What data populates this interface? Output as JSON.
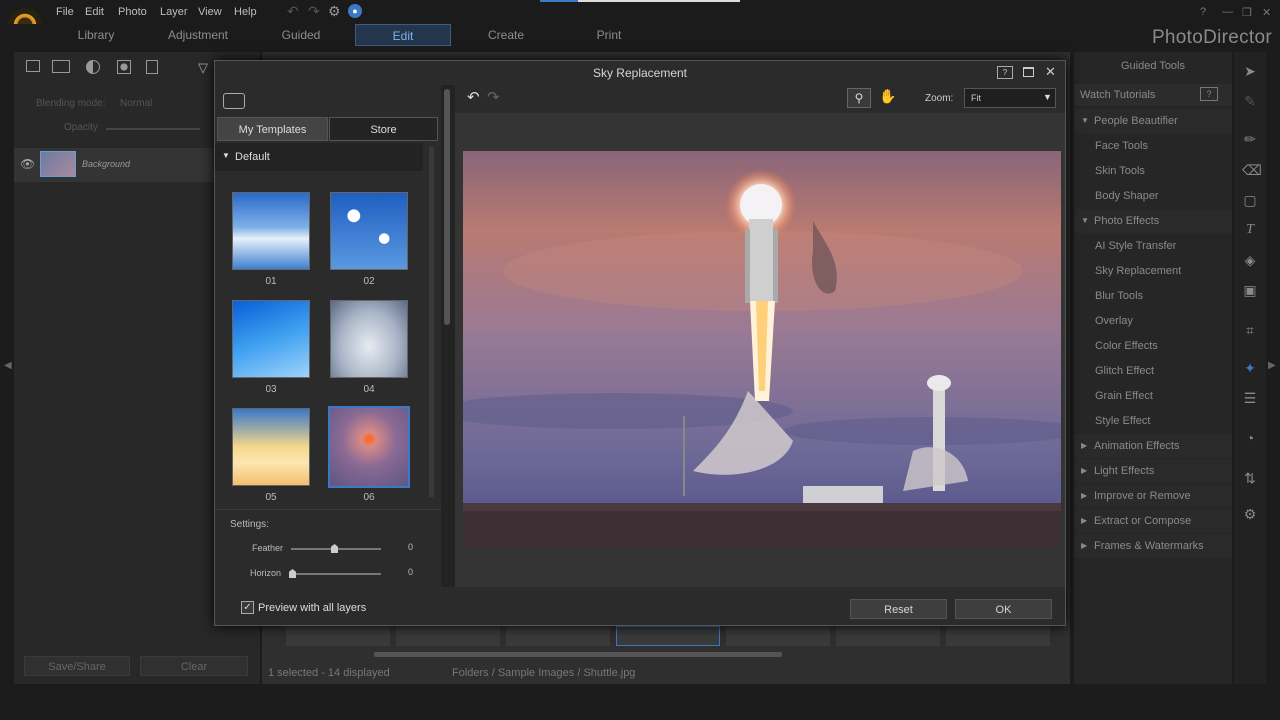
{
  "menu": {
    "items": [
      "File",
      "Edit",
      "Photo",
      "Layer",
      "View",
      "Help"
    ]
  },
  "modules": {
    "tabs": [
      "Library",
      "Adjustment",
      "Guided",
      "Edit",
      "Create",
      "Print"
    ],
    "active": "Edit"
  },
  "brand": "PhotoDirector",
  "left_panel": {
    "blending_label": "Blending mode:",
    "blending_value": "Normal",
    "opacity_label": "Opacity",
    "layer_name": "Background",
    "save_share": "Save/Share",
    "clear": "Clear"
  },
  "status": {
    "selection": "1 selected - 14 displayed",
    "path": "Folders / Sample Images / Shuttle.jpg"
  },
  "right_panel": {
    "title": "Guided Tools",
    "watch_tutorials": "Watch Tutorials",
    "sections": [
      {
        "label": "People Beautifier",
        "expanded": true,
        "items": [
          "Face Tools",
          "Skin Tools",
          "Body Shaper"
        ]
      },
      {
        "label": "Photo Effects",
        "expanded": true,
        "items": [
          "AI Style Transfer",
          "Sky Replacement",
          "Blur Tools",
          "Overlay",
          "Color Effects",
          "Glitch Effect",
          "Grain Effect",
          "Style Effect"
        ]
      },
      {
        "label": "Animation Effects",
        "expanded": false,
        "items": []
      },
      {
        "label": "Light Effects",
        "expanded": false,
        "items": []
      },
      {
        "label": "Improve or Remove",
        "expanded": false,
        "items": []
      },
      {
        "label": "Extract or Compose",
        "expanded": false,
        "items": []
      },
      {
        "label": "Frames & Watermarks",
        "expanded": false,
        "items": []
      }
    ]
  },
  "dialog": {
    "title": "Sky Replacement",
    "tabs": [
      "My Templates",
      "Store"
    ],
    "active_tab": "My Templates",
    "group": "Default",
    "templates": [
      "01",
      "02",
      "03",
      "04",
      "05",
      "06"
    ],
    "selected_template": "06",
    "settings_label": "Settings:",
    "feather_label": "Feather",
    "feather_value": "0",
    "horizon_label": "Horizon",
    "horizon_value": "0",
    "zoom_label": "Zoom:",
    "zoom_value": "Fit",
    "preview_all_layers": "Preview with all layers",
    "preview_checked": true,
    "reset": "Reset",
    "ok": "OK"
  },
  "colors": {
    "accent": "#3b79c4",
    "active_tab_bg": "#23364d",
    "highlight_text": "#6a9fcf"
  }
}
